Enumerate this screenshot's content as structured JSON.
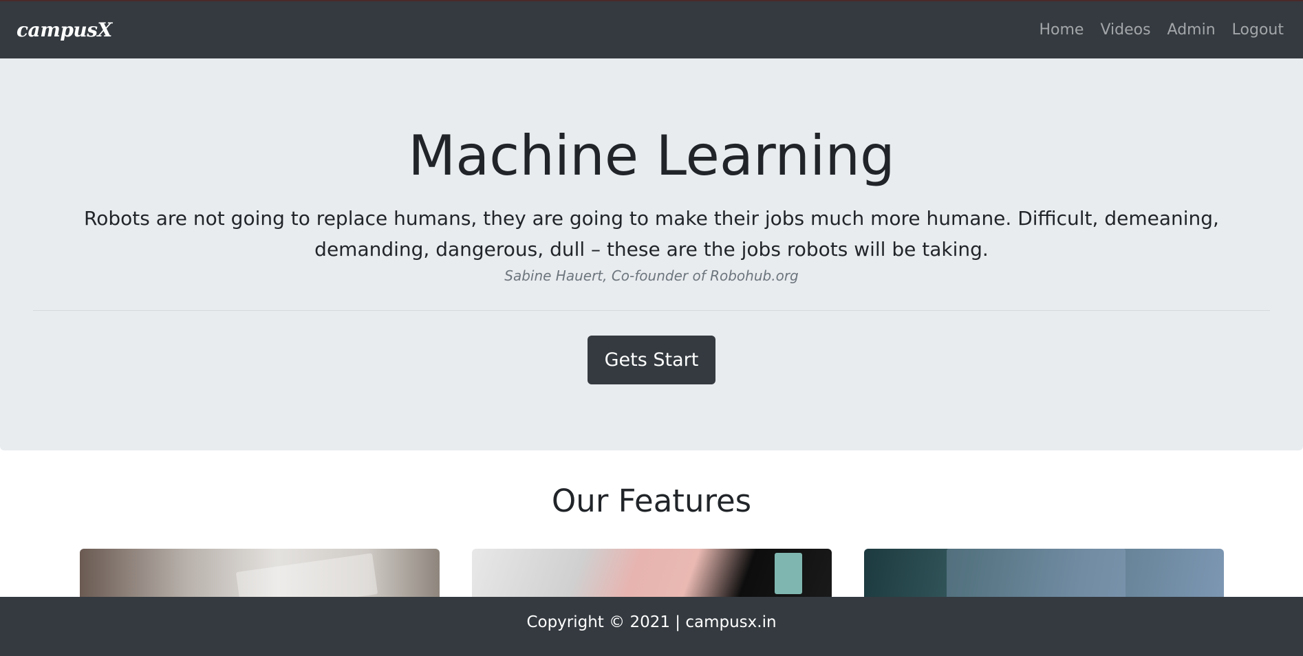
{
  "navbar": {
    "brand": "campusX",
    "links": [
      "Home",
      "Videos",
      "Admin",
      "Logout"
    ]
  },
  "hero": {
    "title": "Machine Learning",
    "quote": "Robots are not going to replace humans, they are going to make their jobs much more humane. Difficult, demeaning, demanding, dangerous, dull – these are the jobs robots will be taking.",
    "author": "Sabine Hauert, Co-founder of Robohub.org",
    "button_label": "Gets Start"
  },
  "features": {
    "title": "Our Features"
  },
  "footer": {
    "text": "Copyright © 2021 | campusx.in"
  },
  "colors": {
    "navbar_bg": "#343a40",
    "jumbotron_bg": "#e9ecef",
    "footer_bg": "#343a40",
    "nav_link": "#9a9da0"
  }
}
